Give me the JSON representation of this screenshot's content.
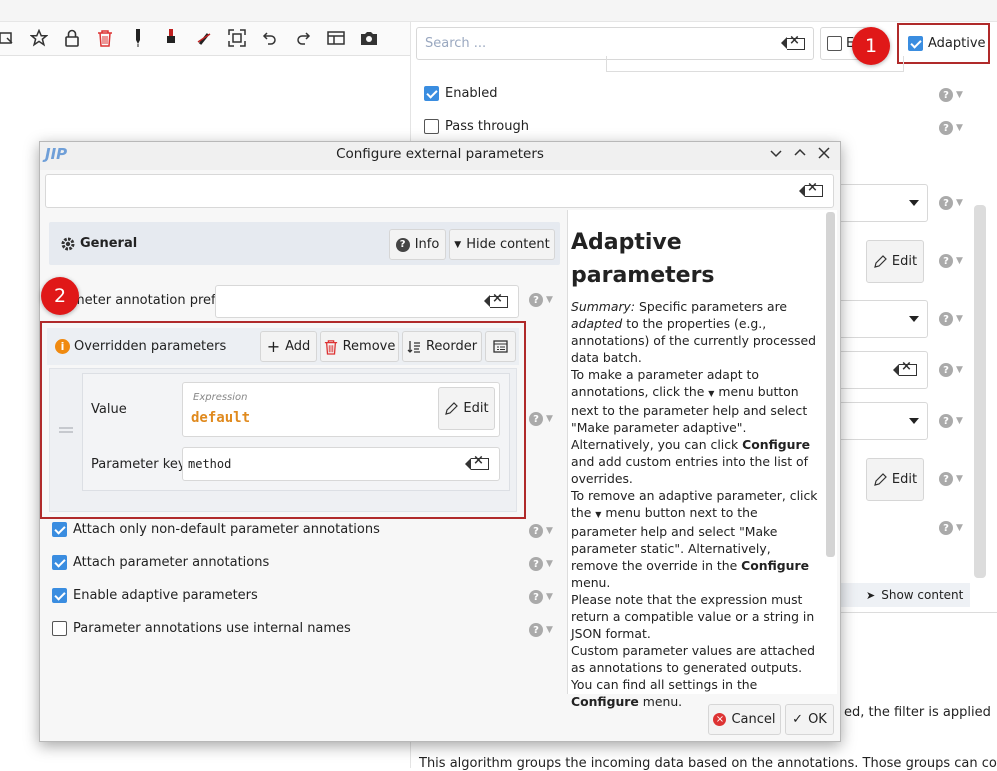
{
  "colors": {
    "accent": "#3a8de0",
    "highlight": "#b02a2a",
    "badge": "#e01818",
    "expression": "#e08a1e"
  },
  "toolbar": {
    "icons": [
      "select-icon",
      "star-icon",
      "lock-icon",
      "trash-icon",
      "pen-icon",
      "brush-icon",
      "erase-icon",
      "fit-icon",
      "undo-icon",
      "redo-icon",
      "layout-icon",
      "camera-icon"
    ]
  },
  "right_panel": {
    "search_placeholder": "Search ...",
    "e_checkbox_label": "E",
    "adaptive_label": "Adaptive",
    "enabled_label": "Enabled",
    "pass_through_label": "Pass through",
    "edit_label": "Edit",
    "show_content_label": "Show content",
    "bottom_text_1": "ed, the filter is applied",
    "bottom_text_2": "This algorithm groups the incoming data based on the annotations. Those groups can consist of"
  },
  "badges": {
    "one": "1",
    "two": "2"
  },
  "dialog": {
    "title": "Configure external parameters",
    "app_logo": "JIP",
    "general_label": "General",
    "info_label": "Info",
    "hide_content_label": "Hide content",
    "prefix_label": "meter annotation prefix",
    "overridden_label": "Overridden parameters",
    "add_label": "Add",
    "remove_label": "Remove",
    "reorder_label": "Reorder",
    "value_label": "Value",
    "expression_caption": "Expression",
    "expression_value": "default",
    "edit_label": "Edit",
    "param_key_label": "Parameter key",
    "param_key_value": "method",
    "cb1": "Attach only non-default parameter annotations",
    "cb2": "Attach parameter annotations",
    "cb3": "Enable adaptive parameters",
    "cb4": "Parameter annotations use internal names",
    "cancel_label": "Cancel",
    "ok_label": "OK"
  },
  "help": {
    "title": "Adaptive parameters",
    "summary_label": "Summary:",
    "p1_a": " Specific parameters are ",
    "p1_em": "adapted",
    "p1_b": " to the properties (e.g., annotations) of the currently processed data batch.",
    "p2_a": "To make a parameter adapt to annotations, click the ",
    "p2_b": " menu button next to the parameter help and select \"Make parameter adaptive\". Alternatively, you can click ",
    "configure": "Configure",
    "p2_c": " and add custom entries into the list of overrides.",
    "p3_a": "To remove an adaptive parameter, click the ",
    "p3_b": " menu button next to the parameter help and select \"Make parameter static\". Alternatively, remove the override in the ",
    "p3_c": " menu.",
    "p4": "Please note that the expression must return a compatible value or a string in JSON format.",
    "p5_a": "Custom parameter values are attached as annotations to generated outputs. You can find all settings in the ",
    "p5_b": " menu."
  }
}
